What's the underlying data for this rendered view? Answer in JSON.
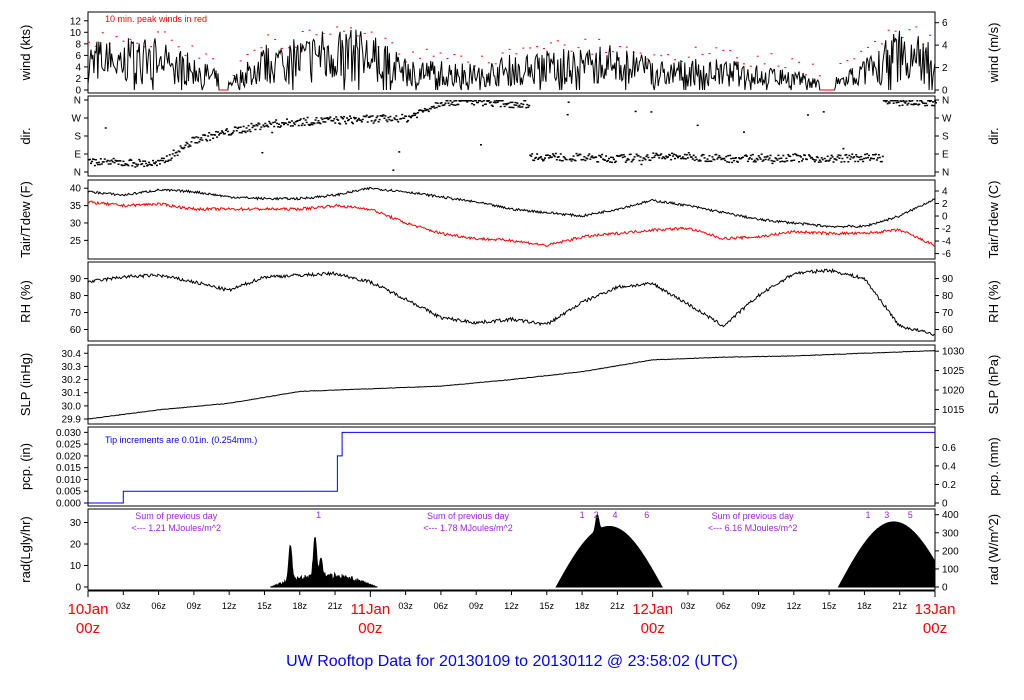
{
  "title": "UW Rooftop Data for 20130109  to  20130112 @ 23:58:02  (UTC)",
  "colors": {
    "line": "#000000",
    "gust": "#ff0000",
    "dew": "#ff0000",
    "pcp": "#0000ff",
    "title": "#0000ff",
    "annotation": "#a020f0",
    "day": "#ff0000"
  },
  "chart_data": {
    "type": "line",
    "x_hours_range": [
      0,
      72
    ],
    "x_ticks_hour": [
      "03z",
      "06z",
      "09z",
      "12z",
      "15z",
      "18z",
      "21z"
    ],
    "x_day_labels": [
      {
        "hour": 0,
        "day": "10Jan",
        "time": "00z"
      },
      {
        "hour": 24,
        "day": "11Jan",
        "time": "00z"
      },
      {
        "hour": 48,
        "day": "12Jan",
        "time": "00z"
      },
      {
        "hour": 72,
        "day": "13Jan",
        "time": "00z"
      }
    ],
    "panels": {
      "wind": {
        "ylabel": "wind (kts)",
        "ylabel_right": "wind (m/s)",
        "ylim": [
          0,
          13
        ],
        "ticks": [
          0,
          2,
          4,
          6,
          8,
          10,
          12
        ],
        "ticks_right": [
          0,
          2,
          4,
          6
        ],
        "note": "10 min. peak winds in red",
        "mean_3hourly_kts": [
          5,
          5,
          5,
          3.5,
          1,
          4.5,
          5,
          6.5,
          5.5,
          3,
          3,
          2.5,
          3.5,
          4,
          4,
          4.5,
          3,
          3,
          3,
          2.5,
          2,
          0.8,
          3,
          6,
          5
        ],
        "calm_periods_hours": [
          [
            11.1,
            11.9
          ],
          [
            62.2,
            63.5
          ]
        ]
      },
      "dir": {
        "ylabel": "dir.",
        "ylabel_right": "dir.",
        "ylim": [
          0,
          360
        ],
        "ticks": [
          {
            "v": 0,
            "l": "N"
          },
          {
            "v": 90,
            "l": "E"
          },
          {
            "v": 180,
            "l": "S"
          },
          {
            "v": 270,
            "l": "W"
          },
          {
            "v": 360,
            "l": "N"
          }
        ],
        "mean_3hourly_deg": [
          55,
          50,
          45,
          165,
          205,
          240,
          255,
          262,
          268,
          272,
          355,
          358,
          345,
          80,
          75,
          70,
          80,
          80,
          70,
          75,
          75,
          70,
          75,
          355,
          352
        ]
      },
      "temp": {
        "ylabel": "Tair/Tdew (F)",
        "ylabel_right": "Tair/Tdew (C)",
        "ylim": [
          20.5,
          41.5
        ],
        "ticks": [
          25,
          30,
          35,
          40
        ],
        "ticks_right_c": [
          -6,
          -4,
          -2,
          0,
          2,
          4
        ],
        "tair_3hourly_f": [
          39,
          38,
          39.5,
          39,
          37.5,
          37,
          37,
          38,
          40,
          39,
          37.5,
          36,
          34,
          33,
          32,
          34,
          36.5,
          35,
          33,
          31,
          30,
          29,
          29,
          32,
          37
        ],
        "tdew_3hourly_f": [
          36,
          35,
          35.5,
          34,
          34,
          34,
          34,
          35,
          34,
          30,
          27,
          25.5,
          25,
          23.5,
          26,
          27,
          28,
          28.5,
          25.5,
          26,
          27.5,
          27,
          27,
          28,
          23.5
        ]
      },
      "rh": {
        "ylabel": "RH (%)",
        "ylabel_right": "RH (%)",
        "ylim": [
          55,
          98
        ],
        "ticks": [
          60,
          70,
          80,
          90
        ],
        "ticks_right": [
          60,
          70,
          80,
          90
        ],
        "rh_3hourly": [
          88,
          91,
          92,
          88,
          83,
          91,
          92,
          93,
          88,
          78,
          67,
          64,
          66,
          63,
          76,
          85,
          87,
          75,
          62,
          80,
          93,
          95,
          90,
          62,
          57
        ]
      },
      "slp": {
        "ylabel": "SLP (inHg)",
        "ylabel_right": "SLP (hPa)",
        "ylim": [
          29.885,
          30.44
        ],
        "ticks": [
          29.9,
          30.0,
          30.1,
          30.2,
          30.3,
          30.4
        ],
        "ticks_labels": [
          "29.9",
          "30.0",
          "30.1",
          "30.2",
          "30.3",
          "30.4"
        ],
        "ticks_right_hpa": [
          1015,
          1020,
          1025,
          1030
        ],
        "slp_6hourly_inhg": [
          29.9,
          29.97,
          30.02,
          30.11,
          30.13,
          30.15,
          30.2,
          30.26,
          30.35,
          30.37,
          30.38,
          30.4,
          30.42
        ]
      },
      "pcp": {
        "ylabel": "pcp. (in)",
        "ylabel_right": "pcp. (mm)",
        "ylim": [
          0,
          0.031
        ],
        "ticks": [
          0,
          0.005,
          0.01,
          0.015,
          0.02,
          0.025,
          0.03
        ],
        "ticks_labels": [
          "0.000",
          "0.005",
          "0.010",
          "0.015",
          "0.020",
          "0.025",
          "0.030"
        ],
        "ticks_right_mm": [
          0,
          0.2,
          0.4,
          0.6
        ],
        "note": "Tip increments are 0.01in. (0.254mm.)",
        "steps": [
          {
            "hour": 0,
            "in": 0
          },
          {
            "hour": 3,
            "in": 0.005
          },
          {
            "hour": 21.2,
            "in": 0.02
          },
          {
            "hour": 21.6,
            "in": 0.03
          },
          {
            "hour": 72,
            "in": 0.03
          }
        ]
      },
      "rad": {
        "ylabel": "rad(Lgly/hr)",
        "ylabel_right": "rad (W/m^2)",
        "ylim_wm2": [
          0,
          415
        ],
        "ticks_lgly": [
          0,
          10,
          20,
          30
        ],
        "ticks_right": [
          0,
          100,
          200,
          300,
          400
        ],
        "days": [
          {
            "start": 15.5,
            "end": 24.6,
            "peak": 60,
            "spikes": [
              {
                "hour": 17.2,
                "v": 230
              },
              {
                "hour": 19.3,
                "v": 276
              },
              {
                "hour": 19.8,
                "v": 160
              }
            ]
          },
          {
            "start": 39.8,
            "end": 48.8,
            "peak": 335,
            "spikes": [
              {
                "hour": 43.3,
                "v": 400
              }
            ]
          },
          {
            "start": 63.8,
            "end": 72,
            "peak": 360,
            "spikes": []
          }
        ],
        "annotations": [
          {
            "hour": 7.5,
            "line1": "Sum of previous day",
            "line2": "<--- 1.21 MJoules/m^2"
          },
          {
            "hour": 32.3,
            "line1": "Sum of previous day",
            "line2": "<--- 1.78 MJoules/m^2"
          },
          {
            "hour": 56.5,
            "line1": "Sum of previous day",
            "line2": "<--- 6.16 MJoules/m^2"
          }
        ],
        "hour_marks": [
          {
            "hour": 19.6,
            "l": "1"
          },
          {
            "hour": 42.0,
            "l": "1"
          },
          {
            "hour": 43.2,
            "l": "2"
          },
          {
            "hour": 44.8,
            "l": "4"
          },
          {
            "hour": 47.5,
            "l": "6"
          },
          {
            "hour": 66.3,
            "l": "1"
          },
          {
            "hour": 67.9,
            "l": "3"
          },
          {
            "hour": 69.9,
            "l": "5"
          }
        ]
      }
    }
  }
}
